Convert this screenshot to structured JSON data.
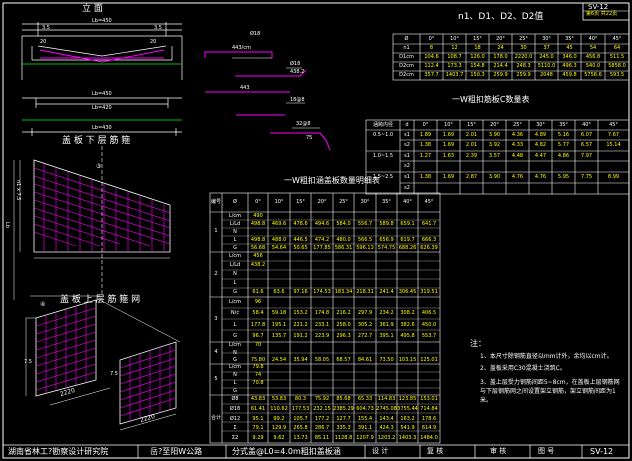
{
  "header": {
    "sheet_code": "SV-12",
    "sheet_sub": "第6页 共22页"
  },
  "elevation": {
    "title": "立 面",
    "dim_top_lb": "Lb=450",
    "dim_left": "3.5",
    "dim_right": "3.5",
    "dim_mid_left": "20",
    "dim_mid_right": "20",
    "dim_bottom": "Lb=450",
    "dim_inner": "Lb=420",
    "dim_bar": "Lb=430",
    "caption": "盖 板 下 层 筋 箍"
  },
  "bars": [
    {
      "id": "bar1",
      "label_top": "Ø18",
      "label_bot": "443/cm",
      "mark": "①"
    },
    {
      "id": "bar2",
      "label_top": "Ø18",
      "label_bot": "438.2",
      "mark": "②"
    },
    {
      "id": "bar3",
      "label_top": "443",
      "label_bot": "",
      "mark": ""
    },
    {
      "id": "bar4",
      "label_top": "18@8",
      "label_bot": "",
      "mark": "③"
    },
    {
      "id": "bar5",
      "label_top": "32@8",
      "label_bot": "75",
      "mark": "④"
    }
  ],
  "plan": {
    "caption_lower": "盖 板 上 层 筋 箍 网",
    "dim_lb": "Lb",
    "dim_side": "n1 x 7.5",
    "dim_bottom1": "7.5",
    "dim_bottom2": "2220",
    "dim_bottom3": "7.5",
    "dim_bottom4": "2220",
    "mark_left_top": "③",
    "mark_left_bot": "④"
  },
  "table_n": {
    "title": "n1、D1、D2、D2值",
    "headers": [
      "Ø",
      "0°",
      "10°",
      "15°",
      "20°",
      "25°",
      "30°",
      "35°",
      "40°",
      "45°"
    ],
    "rows": [
      [
        "n1",
        "8",
        "12",
        "18",
        "24",
        "30",
        "37",
        "45",
        "54",
        "64"
      ],
      [
        "D1cm",
        "104.6",
        "108.7",
        "126.0",
        "178.0",
        "2220.0",
        "245.0",
        "346.0",
        "456.8",
        "511.5"
      ],
      [
        "D2cm",
        "112.4",
        "173.3",
        "154.8",
        "214.4",
        "248.3",
        "5110.0",
        "496.3",
        "540.0",
        "5858.0"
      ],
      [
        "D2cm",
        "357.7",
        "1403.7",
        "150.3",
        "259.9",
        "259.9",
        "2048",
        "459.8",
        "5758.6",
        "593.5"
      ]
    ]
  },
  "table_qty": {
    "title": "一W粗扣筋板C数量表",
    "headers": [
      "涵跨内径",
      "d",
      "0°",
      "10°",
      "15°",
      "20°",
      "25°",
      "30°",
      "35°",
      "40°",
      "45°"
    ],
    "rows": [
      [
        "0.5~1.0",
        "s1",
        "1.89",
        "1.69",
        "2.01",
        "3.90",
        "4.36",
        "4.89",
        "5.16",
        "6.07",
        "7.67"
      ],
      [
        "",
        "s2",
        "1.38",
        "1.69",
        "2.01",
        "3.92",
        "4.33",
        "4.82",
        "5.77",
        "6.57",
        "15.14"
      ],
      [
        "1.0~1.5",
        "s1",
        "1.27",
        "1.63",
        "2.39",
        "3.57",
        "4.48",
        "4.47",
        "4.86",
        "7.97",
        ""
      ],
      [
        "",
        "s2",
        "",
        "",
        "",
        "",
        "",
        "",
        "",
        "",
        ""
      ],
      [
        "1.5~2.5",
        "s1",
        "1.38",
        "1.69",
        "2.87",
        "3.90",
        "4.76",
        "4.76",
        "5.95",
        "7.75",
        "8.99"
      ],
      [
        "",
        "s2",
        "",
        "",
        "",
        "",
        "",
        "",
        "",
        "",
        ""
      ]
    ]
  },
  "table_main": {
    "title": "一W粗扣涵盖板数量明细表",
    "headers": [
      "编号",
      "Ø",
      "0°",
      "10°",
      "15°",
      "20°",
      "25°",
      "30°",
      "35°",
      "40°",
      "45°"
    ],
    "groups": [
      {
        "no": "1",
        "rows": [
          [
            "L/cm",
            "490",
            "",
            "",
            "",
            "",
            "",
            "",
            "",
            ""
          ],
          [
            "L/Ld",
            "498.8",
            "469.6",
            "478.6",
            "494.6",
            "584.0",
            "556.7",
            "589.8",
            "659.1",
            "641.7"
          ],
          [
            "N",
            "",
            "",
            "",
            "",
            "",
            "",
            "",
            "",
            ""
          ],
          [
            "L",
            "498.8",
            "488.0",
            "446.5",
            "474.2",
            "480.0",
            "566.5",
            "656.9",
            "619.7",
            "666.3"
          ],
          [
            "G",
            "56.68",
            "54.64",
            "50.65",
            "177.85",
            "586.31",
            "596.13",
            "574.75",
            "688.26",
            "626.39"
          ]
        ]
      },
      {
        "no": "2",
        "rows": [
          [
            "L/cm",
            "456",
            "",
            "",
            "",
            "",
            "",
            "",
            "",
            ""
          ],
          [
            "L/Ld",
            "438.2",
            "",
            "",
            "",
            "",
            "",
            "",
            "",
            ""
          ],
          [
            "N",
            "",
            "",
            "",
            "",
            "",
            "",
            "",
            "",
            ""
          ],
          [
            "L",
            "",
            "",
            "",
            "",
            "",
            "",
            "",
            "",
            ""
          ],
          [
            "G",
            "61.6",
            "63.6",
            "97.16",
            "174.53",
            "183.34",
            "218.31",
            "241.4",
            "306.45",
            "319.51"
          ]
        ]
      },
      {
        "no": "3",
        "rows": [
          [
            "L/cm",
            "96",
            "",
            "",
            "",
            "",
            "",
            "",
            "",
            ""
          ],
          [
            "N/c",
            "58.4",
            "59.18",
            "153.2",
            "174.8",
            "216.2",
            "297.9",
            "234.2",
            "308.2",
            "406.5"
          ],
          [
            "L",
            "177.8",
            "195.1",
            "221.2",
            "233.1",
            "258.0",
            "305.2",
            "361.9",
            "382.6",
            "450.0"
          ],
          [
            "G",
            "96.7",
            "135.7",
            "191.2",
            "223.9",
            "296.3",
            "272.7",
            "395.1",
            "495.8",
            "553.7"
          ]
        ]
      },
      {
        "no": "4",
        "rows": [
          [
            "L/cm",
            "70",
            "",
            "",
            "",
            "",
            "",
            "",
            "",
            ""
          ],
          [
            "N",
            "",
            "",
            "",
            "",
            "",
            "",
            "",
            "",
            ""
          ],
          [
            "G",
            "75.80",
            "24.54",
            "35.94",
            "58.05",
            "68.57",
            "84.61",
            "73.50",
            "103.15",
            "125.01"
          ]
        ]
      },
      {
        "no": "5",
        "rows": [
          [
            "L/cm",
            "79.8",
            "",
            "",
            "",
            "",
            "",
            "",
            "",
            ""
          ],
          [
            "N",
            "74",
            "",
            "",
            "",
            "",
            "",
            "",
            "",
            ""
          ],
          [
            "L",
            "70.8",
            "",
            "",
            "",
            "",
            "",
            "",
            "",
            ""
          ],
          [
            "G",
            "",
            "",
            "",
            "",
            "",
            "",
            "",
            "",
            ""
          ]
        ]
      },
      {
        "no": "合计",
        "rows": [
          [
            "Ø8",
            "43.83",
            "53.83",
            "80.3",
            "75.92",
            "85.68",
            "65.33",
            "114.83",
            "123.85",
            "153.01"
          ],
          [
            "Ø18",
            "61.41",
            "110.62",
            "177.53",
            "232.15",
            "2385.29",
            "604.73",
            "2745.08",
            "3755.44",
            "714.84"
          ],
          [
            "Ø12",
            "95.1",
            "99.2",
            "105.7",
            "177.2",
            "127.7",
            "155.4",
            "143.4",
            "163.2",
            "178.6"
          ],
          [
            "Σ",
            "79.1",
            "129.9",
            "265.8",
            "286.7",
            "335.3",
            "391.1",
            "424.3",
            "541.9",
            "614.9"
          ],
          [
            "Σ2",
            "9.29",
            "9.62",
            "13.73",
            "85.11",
            "1128.8",
            "1207.9",
            "1203.2",
            "1403.3",
            "1484.0"
          ]
        ]
      }
    ]
  },
  "notes": {
    "title": "注：",
    "items": [
      "1、本尺寸除钢筋直径以mm计外，余均以cm计。",
      "2、盖板采用C30混凝土浇筑C。",
      "3、盖上层受力钢筋间距5~8cm，在盖板上层钢筋网与下层钢筋网之间设置架立钢筋，架立钢筋间距为1米。"
    ]
  },
  "title_block": {
    "org": "湖南省林工?勘察设计研究院",
    "project": "岳?至阳W公路",
    "drawing": "分式盖@L0=4.0m粗扣盖板涵",
    "design": "设 计",
    "check": "复 核",
    "approve": "审 核",
    "page_label": "图 号",
    "code": "SV-12"
  }
}
